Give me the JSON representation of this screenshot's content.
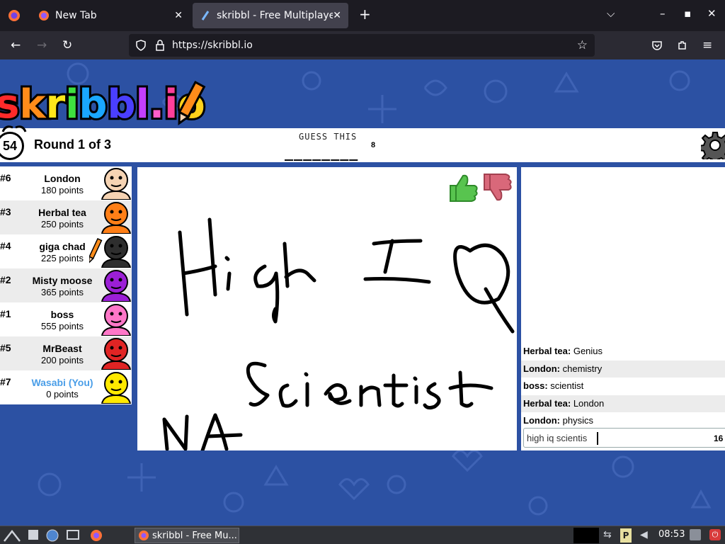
{
  "browser": {
    "tabs": [
      {
        "label": "New Tab"
      },
      {
        "label": "skribbl - Free Multiplayer"
      }
    ],
    "url": "https://skribbl.io"
  },
  "game": {
    "logo_text": "skribbl.io",
    "timer": "54",
    "round": "Round 1 of 3",
    "guess_label": "GUESS THIS",
    "word_blanks": "________",
    "word_length": "8"
  },
  "players": [
    {
      "rank": "#6",
      "name": "London",
      "points": "180 points",
      "color": "#f5d3b3",
      "you": false
    },
    {
      "rank": "#3",
      "name": "Herbal tea",
      "points": "250 points",
      "color": "#ff7f17",
      "you": false
    },
    {
      "rank": "#4",
      "name": "giga chad",
      "points": "225 points",
      "color": "#2e2e2e",
      "you": false,
      "drawing": true
    },
    {
      "rank": "#2",
      "name": "Misty moose",
      "points": "365 points",
      "color": "#9b1fd6",
      "you": false
    },
    {
      "rank": "#1",
      "name": "boss",
      "points": "555 points",
      "color": "#ff77c8",
      "you": false
    },
    {
      "rank": "#5",
      "name": "MrBeast",
      "points": "200 points",
      "color": "#e02424",
      "you": false
    },
    {
      "rank": "#7",
      "name": "Wasabi (You)",
      "points": "0 points",
      "color": "#ffe900",
      "you": true
    }
  ],
  "chat": {
    "messages": [
      {
        "name": "Herbal tea:",
        "text": "Genius"
      },
      {
        "name": "London:",
        "text": "chemistry"
      },
      {
        "name": "boss:",
        "text": "scientist"
      },
      {
        "name": "Herbal tea:",
        "text": "London"
      },
      {
        "name": "London:",
        "text": "physics"
      }
    ],
    "input_value": "high iq scientis",
    "char_count": "16"
  },
  "taskbar": {
    "window_label": "skribbl - Free Mu...",
    "time": "08:53"
  },
  "colors": {
    "page_bg": "#2c51a3",
    "thumb_up": "#58c44f",
    "thumb_down": "#d9687a",
    "you_name": "#4a9ee8"
  }
}
